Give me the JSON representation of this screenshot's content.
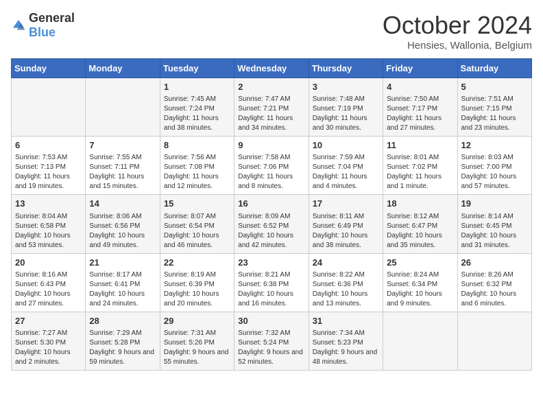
{
  "header": {
    "logo_general": "General",
    "logo_blue": "Blue",
    "month_title": "October 2024",
    "location": "Hensies, Wallonia, Belgium"
  },
  "days_of_week": [
    "Sunday",
    "Monday",
    "Tuesday",
    "Wednesday",
    "Thursday",
    "Friday",
    "Saturday"
  ],
  "weeks": [
    [
      {
        "day": "",
        "info": ""
      },
      {
        "day": "",
        "info": ""
      },
      {
        "day": "1",
        "info": "Sunrise: 7:45 AM\nSunset: 7:24 PM\nDaylight: 11 hours and 38 minutes."
      },
      {
        "day": "2",
        "info": "Sunrise: 7:47 AM\nSunset: 7:21 PM\nDaylight: 11 hours and 34 minutes."
      },
      {
        "day": "3",
        "info": "Sunrise: 7:48 AM\nSunset: 7:19 PM\nDaylight: 11 hours and 30 minutes."
      },
      {
        "day": "4",
        "info": "Sunrise: 7:50 AM\nSunset: 7:17 PM\nDaylight: 11 hours and 27 minutes."
      },
      {
        "day": "5",
        "info": "Sunrise: 7:51 AM\nSunset: 7:15 PM\nDaylight: 11 hours and 23 minutes."
      }
    ],
    [
      {
        "day": "6",
        "info": "Sunrise: 7:53 AM\nSunset: 7:13 PM\nDaylight: 11 hours and 19 minutes."
      },
      {
        "day": "7",
        "info": "Sunrise: 7:55 AM\nSunset: 7:11 PM\nDaylight: 11 hours and 15 minutes."
      },
      {
        "day": "8",
        "info": "Sunrise: 7:56 AM\nSunset: 7:08 PM\nDaylight: 11 hours and 12 minutes."
      },
      {
        "day": "9",
        "info": "Sunrise: 7:58 AM\nSunset: 7:06 PM\nDaylight: 11 hours and 8 minutes."
      },
      {
        "day": "10",
        "info": "Sunrise: 7:59 AM\nSunset: 7:04 PM\nDaylight: 11 hours and 4 minutes."
      },
      {
        "day": "11",
        "info": "Sunrise: 8:01 AM\nSunset: 7:02 PM\nDaylight: 11 hours and 1 minute."
      },
      {
        "day": "12",
        "info": "Sunrise: 8:03 AM\nSunset: 7:00 PM\nDaylight: 10 hours and 57 minutes."
      }
    ],
    [
      {
        "day": "13",
        "info": "Sunrise: 8:04 AM\nSunset: 6:58 PM\nDaylight: 10 hours and 53 minutes."
      },
      {
        "day": "14",
        "info": "Sunrise: 8:06 AM\nSunset: 6:56 PM\nDaylight: 10 hours and 49 minutes."
      },
      {
        "day": "15",
        "info": "Sunrise: 8:07 AM\nSunset: 6:54 PM\nDaylight: 10 hours and 46 minutes."
      },
      {
        "day": "16",
        "info": "Sunrise: 8:09 AM\nSunset: 6:52 PM\nDaylight: 10 hours and 42 minutes."
      },
      {
        "day": "17",
        "info": "Sunrise: 8:11 AM\nSunset: 6:49 PM\nDaylight: 10 hours and 38 minutes."
      },
      {
        "day": "18",
        "info": "Sunrise: 8:12 AM\nSunset: 6:47 PM\nDaylight: 10 hours and 35 minutes."
      },
      {
        "day": "19",
        "info": "Sunrise: 8:14 AM\nSunset: 6:45 PM\nDaylight: 10 hours and 31 minutes."
      }
    ],
    [
      {
        "day": "20",
        "info": "Sunrise: 8:16 AM\nSunset: 6:43 PM\nDaylight: 10 hours and 27 minutes."
      },
      {
        "day": "21",
        "info": "Sunrise: 8:17 AM\nSunset: 6:41 PM\nDaylight: 10 hours and 24 minutes."
      },
      {
        "day": "22",
        "info": "Sunrise: 8:19 AM\nSunset: 6:39 PM\nDaylight: 10 hours and 20 minutes."
      },
      {
        "day": "23",
        "info": "Sunrise: 8:21 AM\nSunset: 6:38 PM\nDaylight: 10 hours and 16 minutes."
      },
      {
        "day": "24",
        "info": "Sunrise: 8:22 AM\nSunset: 6:36 PM\nDaylight: 10 hours and 13 minutes."
      },
      {
        "day": "25",
        "info": "Sunrise: 8:24 AM\nSunset: 6:34 PM\nDaylight: 10 hours and 9 minutes."
      },
      {
        "day": "26",
        "info": "Sunrise: 8:26 AM\nSunset: 6:32 PM\nDaylight: 10 hours and 6 minutes."
      }
    ],
    [
      {
        "day": "27",
        "info": "Sunrise: 7:27 AM\nSunset: 5:30 PM\nDaylight: 10 hours and 2 minutes."
      },
      {
        "day": "28",
        "info": "Sunrise: 7:29 AM\nSunset: 5:28 PM\nDaylight: 9 hours and 59 minutes."
      },
      {
        "day": "29",
        "info": "Sunrise: 7:31 AM\nSunset: 5:26 PM\nDaylight: 9 hours and 55 minutes."
      },
      {
        "day": "30",
        "info": "Sunrise: 7:32 AM\nSunset: 5:24 PM\nDaylight: 9 hours and 52 minutes."
      },
      {
        "day": "31",
        "info": "Sunrise: 7:34 AM\nSunset: 5:23 PM\nDaylight: 9 hours and 48 minutes."
      },
      {
        "day": "",
        "info": ""
      },
      {
        "day": "",
        "info": ""
      }
    ]
  ]
}
